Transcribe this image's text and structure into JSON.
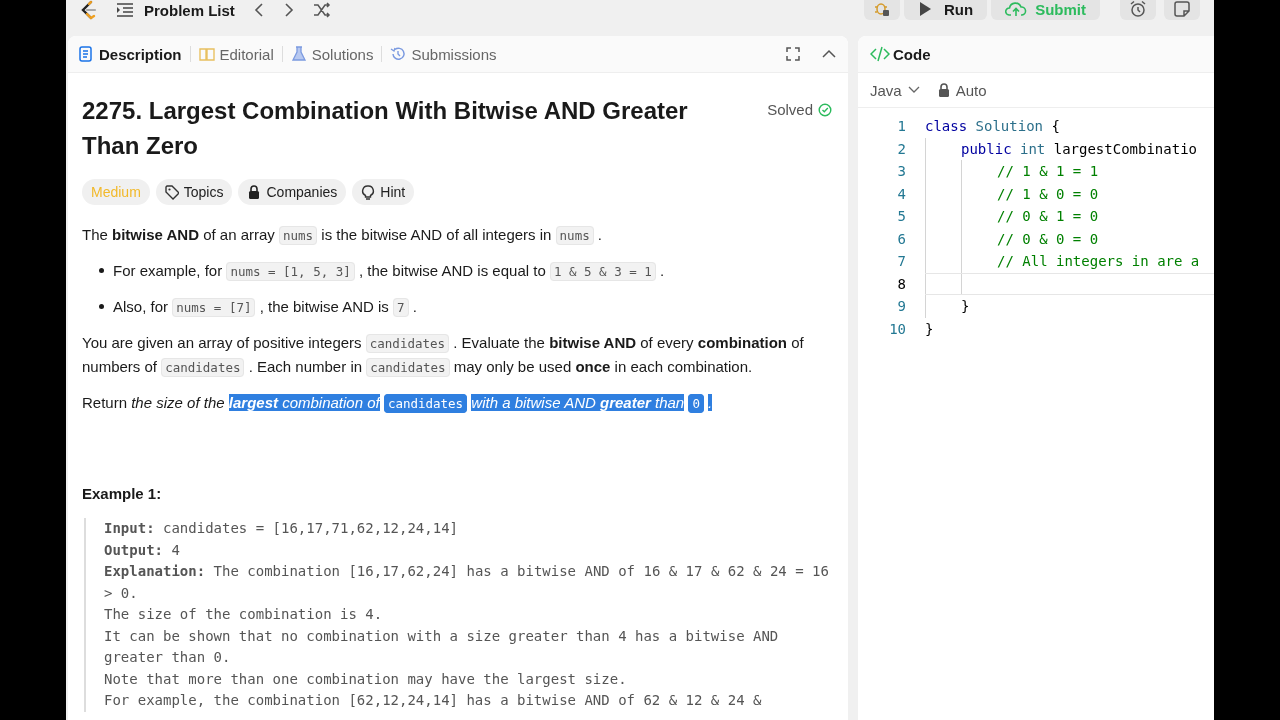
{
  "top_bar": {
    "problem_list": "Problem List",
    "run": "Run",
    "submit": "Submit"
  },
  "description_panel": {
    "tabs": [
      {
        "label": "Description",
        "selected": true
      },
      {
        "label": "Editorial",
        "selected": false
      },
      {
        "label": "Solutions",
        "selected": false
      },
      {
        "label": "Submissions",
        "selected": false
      }
    ],
    "title": "2275. Largest Combination With Bitwise AND Greater Than Zero",
    "status": "Solved",
    "tags": [
      {
        "label": "Medium",
        "kind": "difficulty"
      },
      {
        "label": "Topics",
        "kind": "tag"
      },
      {
        "label": "Companies",
        "kind": "lock"
      },
      {
        "label": "Hint",
        "kind": "bulb"
      }
    ],
    "paragraphs": [
      {
        "kind": "plain",
        "segments": [
          {
            "kind": "text",
            "text": "The **bitwise AND** of an array"
          },
          {
            "kind": "code",
            "text": "nums"
          },
          {
            "kind": "text",
            "text": "is the bitwise AND of all integers in"
          },
          {
            "kind": "code",
            "text": "nums"
          },
          {
            "kind": "text",
            "text": "."
          }
        ]
      },
      {
        "kind": "bullet",
        "segments": [
          {
            "kind": "text",
            "text": "For example, for"
          },
          {
            "kind": "code",
            "text": "nums = [1, 5, 3]"
          },
          {
            "kind": "text",
            "text": ", the bitwise AND is equal to"
          },
          {
            "kind": "code",
            "text": "1 & 5 & 3 = 1"
          },
          {
            "kind": "text",
            "text": "."
          }
        ]
      },
      {
        "kind": "bullet",
        "segments": [
          {
            "kind": "text",
            "text": "Also, for"
          },
          {
            "kind": "code",
            "text": "nums = [7]"
          },
          {
            "kind": "text",
            "text": ", the bitwise AND is"
          },
          {
            "kind": "code",
            "text": "7"
          },
          {
            "kind": "text",
            "text": "."
          }
        ]
      },
      {
        "kind": "plain",
        "segments": [
          {
            "kind": "text",
            "text": "You are given an array of positive integers"
          },
          {
            "kind": "code",
            "text": "candidates"
          },
          {
            "kind": "text",
            "text": ". Evaluate the **bitwise AND** of every **combination** of"
          },
          {
            "kind": "text",
            "text": "numbers of"
          },
          {
            "kind": "code",
            "text": "candidates"
          },
          {
            "kind": "text",
            "text": ". Each number in"
          },
          {
            "kind": "code",
            "text": "candidates"
          },
          {
            "kind": "text",
            "text": "may only be used **once** in each combination."
          }
        ]
      },
      {
        "kind": "plain",
        "segments": [
          {
            "kind": "text",
            "text": "Return *the size of the*",
            "selected": false
          },
          {
            "kind": "italic",
            "text": "**largest** combination of",
            "selected": true
          },
          {
            "kind": "code",
            "text": "candidates",
            "selected": true
          },
          {
            "kind": "italic",
            "text": "with a bitwise AND **greater** than",
            "selected": true
          },
          {
            "kind": "code",
            "text": "0",
            "selected": true
          },
          {
            "kind": "italic",
            "text": ".",
            "selected": true
          }
        ]
      }
    ],
    "example_title": "Example 1:",
    "example_lines": [
      "**Input:** candidates = [16,17,71,62,12,24,14]",
      "**Output:** 4",
      "**Explanation:** The combination [16,17,62,24] has a bitwise AND of 16 & 17 & 62 & 24 = 16 > 0.",
      "The size of the combination is 4.",
      "It can be shown that no combination with a size greater than 4 has a bitwise AND greater than 0.",
      "Note that more than one combination may have the largest size.",
      "For example, the combination [62,12,24,14] has a bitwise AND of 62 & 12 & 24 &"
    ]
  },
  "code_panel": {
    "title": "Code",
    "language": "Java",
    "mode": "Auto",
    "lines": [
      {
        "number": "1",
        "current": false,
        "tokens": [
          {
            "kind": "keyword",
            "text": "class"
          },
          {
            "kind": "type",
            "text": " Solution"
          },
          {
            "kind": "plain",
            "text": " {"
          }
        ],
        "children": [
          {
            "number": "2",
            "current": false,
            "tokens": [
              {
                "kind": "keyword",
                "text": "public"
              },
              {
                "kind": "type",
                "text": " int"
              },
              {
                "kind": "plain",
                "text": " largestCombinatio"
              }
            ],
            "children": [
              {
                "number": "3",
                "current": false,
                "tokens": [
                  {
                    "kind": "comment",
                    "text": "// 1 & 1 = 1"
                  }
                ]
              },
              {
                "number": "4",
                "current": false,
                "tokens": [
                  {
                    "kind": "comment",
                    "text": "// 1 & 0 = 0"
                  }
                ]
              },
              {
                "number": "5",
                "current": false,
                "tokens": [
                  {
                    "kind": "comment",
                    "text": "// 0 & 1 = 0"
                  }
                ]
              },
              {
                "number": "6",
                "current": false,
                "tokens": [
                  {
                    "kind": "comment",
                    "text": "// 0 & 0 = 0"
                  }
                ]
              },
              {
                "number": "7",
                "current": false,
                "tokens": [
                  {
                    "kind": "comment",
                    "text": "// All integers in are a"
                  }
                ]
              },
              {
                "number": "8",
                "current": true
              }
            ]
          },
          {
            "number": "9",
            "current": false,
            "tokens": [
              {
                "kind": "plain",
                "text": "}"
              }
            ]
          }
        ]
      },
      {
        "number": "10",
        "current": false,
        "tokens": [
          {
            "kind": "plain",
            "text": "}"
          }
        ]
      }
    ]
  }
}
